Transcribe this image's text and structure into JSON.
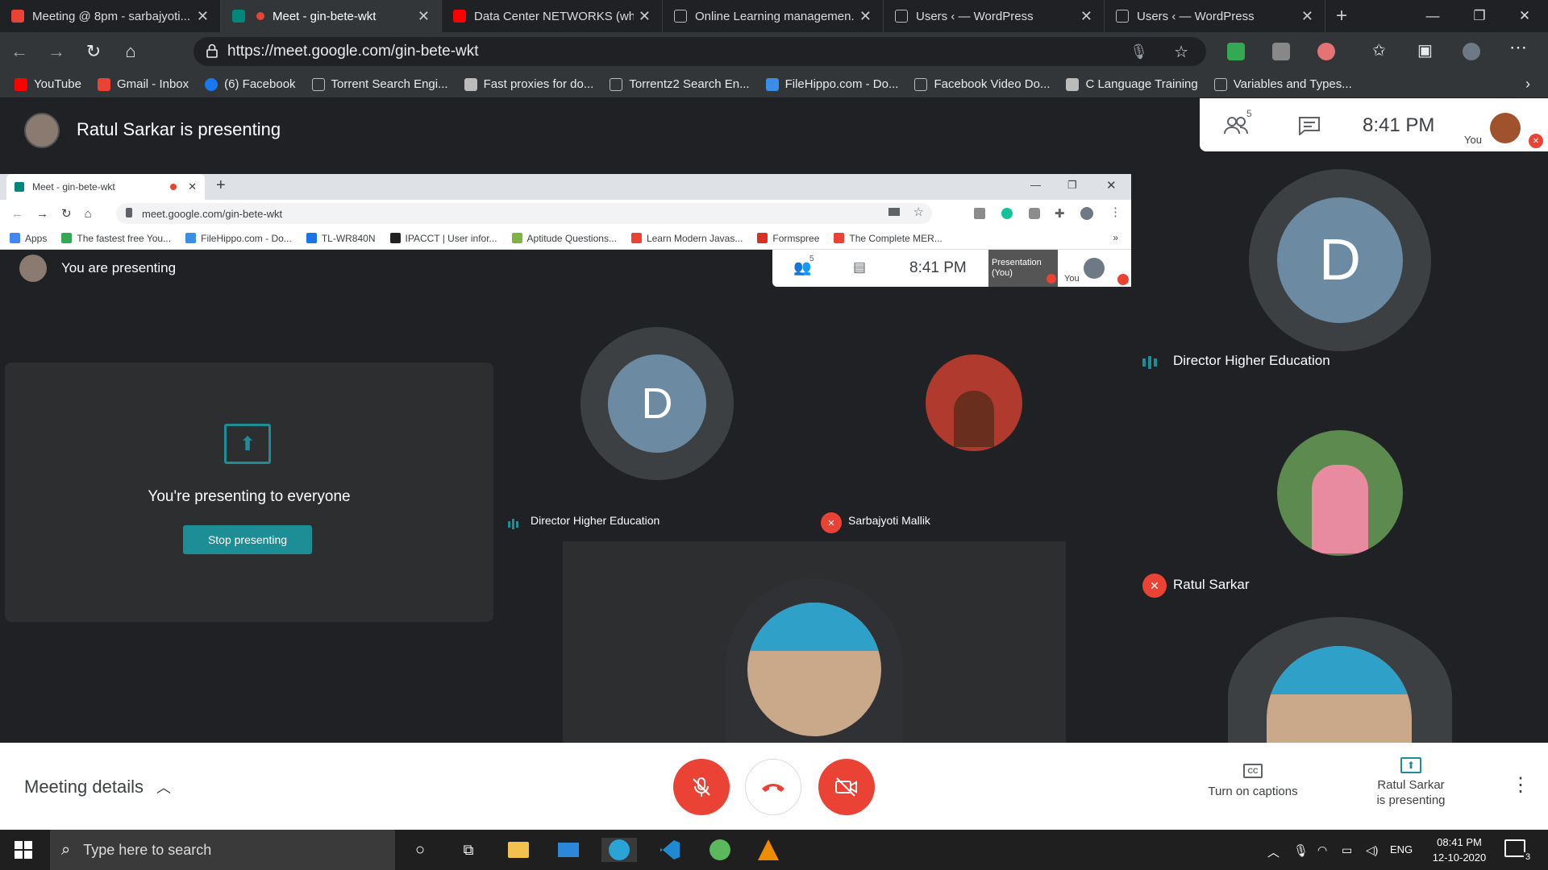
{
  "browser": {
    "tabs": [
      {
        "title": "Meeting @ 8pm - sarbajyoti...",
        "favicon": "gmail-icon",
        "color": "#ea4335"
      },
      {
        "title": "Meet - gin-bete-wkt",
        "favicon": "meet-icon",
        "color": "#00897b",
        "recording": true
      },
      {
        "title": "Data Center NETWORKS (wh...",
        "favicon": "youtube-icon",
        "color": "#ff0000"
      },
      {
        "title": "Online Learning managemen...",
        "favicon": "page-icon",
        "color": "#9aa0a6"
      },
      {
        "title": "Users ‹ — WordPress",
        "favicon": "page-icon",
        "color": "#9aa0a6"
      },
      {
        "title": "Users ‹ — WordPress",
        "favicon": "page-icon",
        "color": "#9aa0a6"
      }
    ],
    "url": "https://meet.google.com/gin-bete-wkt",
    "bookmarks": [
      {
        "label": "YouTube",
        "color": "#ff0000"
      },
      {
        "label": "Gmail - Inbox",
        "color": "#ea4335"
      },
      {
        "label": "(6) Facebook",
        "color": "#1877f2"
      },
      {
        "label": "Torrent Search Engi...",
        "color": "#9aa0a6"
      },
      {
        "label": "Fast proxies for do...",
        "color": "#bbbbbb"
      },
      {
        "label": "Torrentz2 Search En...",
        "color": "#9aa0a6"
      },
      {
        "label": "FileHippo.com - Do...",
        "color": "#3a8ee6"
      },
      {
        "label": "Facebook Video Do...",
        "color": "#9aa0a6"
      },
      {
        "label": "C Language Training",
        "color": "#bbbbbb"
      },
      {
        "label": "Variables and Types...",
        "color": "#9aa0a6"
      }
    ]
  },
  "meet": {
    "presenter_banner": "Ratul Sarkar is presenting",
    "participants_count": "5",
    "time": "8:41 PM",
    "you_label": "You",
    "participants": [
      {
        "name": "Director Higher Education",
        "initial": "D",
        "speaking": true
      },
      {
        "name": "Ratul Sarkar",
        "muted": true
      }
    ]
  },
  "shared_screen": {
    "tab_title": "Meet - gin-bete-wkt",
    "url": "meet.google.com/gin-bete-wkt",
    "bookmarks": [
      {
        "label": "Apps",
        "color": "#4285f4"
      },
      {
        "label": "The fastest free You...",
        "color": "#34a853"
      },
      {
        "label": "FileHippo.com - Do...",
        "color": "#3a8ee6"
      },
      {
        "label": "TL-WR840N",
        "color": "#1a73e8"
      },
      {
        "label": "IPACCT | User infor...",
        "color": "#222222"
      },
      {
        "label": "Aptitude Questions...",
        "color": "#7cb342"
      },
      {
        "label": "Learn Modern Javas...",
        "color": "#ea4335"
      },
      {
        "label": "Formspree",
        "color": "#d93025"
      },
      {
        "label": "The Complete MER...",
        "color": "#ea4335"
      }
    ],
    "presenting_banner": "You are presenting",
    "participants_count": "5",
    "time": "8:41 PM",
    "presentation_label": "Presentation (You)",
    "you_label": "You",
    "presenting_card_title": "You're presenting to everyone",
    "stop_presenting": "Stop presenting",
    "tiles": [
      {
        "name": "Director Higher Education",
        "initial": "D"
      },
      {
        "name": "Sarbajyoti Mallik"
      }
    ]
  },
  "bottom_bar": {
    "meeting_details": "Meeting details",
    "captions": "Turn on captions",
    "presenting_line1": "Ratul Sarkar",
    "presenting_line2": "is presenting"
  },
  "taskbar": {
    "search_placeholder": "Type here to search",
    "lang": "ENG",
    "time": "08:41 PM",
    "date": "12-10-2020",
    "notifications": "3"
  },
  "colors": {
    "meet_red": "#ea4335",
    "avatar_blue": "#6c8ba3",
    "teal": "#1e8e96",
    "dark_bg": "#202124"
  }
}
